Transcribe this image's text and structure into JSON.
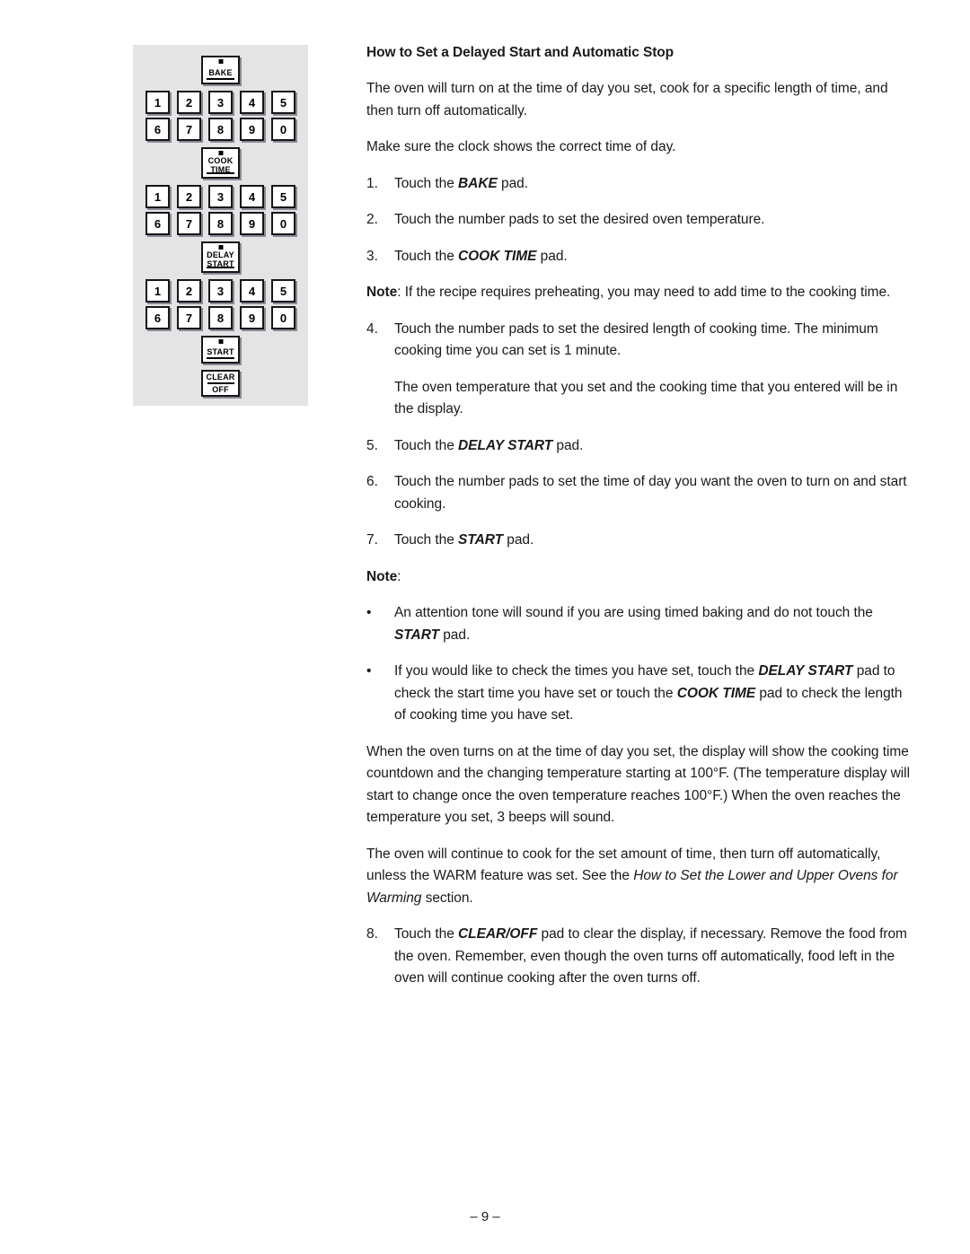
{
  "page": {
    "heading": "How to Set a Delayed Start and Automatic Stop",
    "footer": "– 9 –"
  },
  "keypad": {
    "background_color": "#e4e4e4",
    "key_border_color": "#161616",
    "key_shadow_color": "#8d8a96",
    "number_rows": [
      [
        "1",
        "2",
        "3",
        "4",
        "5"
      ],
      [
        "6",
        "7",
        "8",
        "9",
        "0"
      ]
    ],
    "function_keys": {
      "bake": "Bake",
      "cook_time_line1": "Cook",
      "cook_time_line2": "Time",
      "delay_start_line1": "Delay",
      "delay_start_line2": "Start",
      "start": "Start",
      "clear_off_line1": "Clear",
      "clear_off_line2": "Off"
    }
  },
  "body": {
    "intro_para_1": "The oven will turn on at the time of day you set, cook for a specific length of time, and then turn off automatically.",
    "intro_para_2": "Make sure the clock shows the correct time of day.",
    "steps": [
      {
        "marker": "1.",
        "pre": "Touch the ",
        "pad": "BAKE",
        "post": " pad."
      },
      {
        "marker": "2.",
        "pre": "Touch the number pads to set the desired oven temperature.",
        "pad": "",
        "post": ""
      },
      {
        "marker": "3.",
        "pre": "Touch the ",
        "pad": "COOK TIME",
        "post": " pad."
      }
    ],
    "note_preheat_label": "Note",
    "note_preheat_text": ": If the recipe requires preheating, you may need to add time to the cooking time.",
    "step4_marker": "4.",
    "step4_text": "Touch the number pads to set the desired length of cooking time. The minimum cooking time you can set is 1 minute.",
    "step4_sub": "The oven temperature that you set and the cooking time that you entered will be in the display.",
    "step5_marker": "5.",
    "step5_pre": "Touch the ",
    "step5_pad": "DELAY START",
    "step5_post": " pad.",
    "step6_marker": "6.",
    "step6_text": "Touch the number pads to set the time of day you want the oven to turn on and start cooking.",
    "step7_marker": "7.",
    "step7_pre": "Touch the ",
    "step7_pad": "START",
    "step7_post": " pad.",
    "note_label": "Note",
    "note_colon": ":",
    "bullet_marker": "•",
    "bullet1_pre": "An attention tone will sound if you are using timed baking and do not touch the ",
    "bullet1_pad": "START",
    "bullet1_post": " pad.",
    "bullet2_part1": "If you would like to check the times you have set, touch the ",
    "bullet2_pad1": "DELAY START",
    "bullet2_part2": " pad to check the start time you have set or touch the ",
    "bullet2_pad2": "COOK TIME",
    "bullet2_part3": " pad to check the length of cooking time you have set.",
    "para_when_oven": "When the oven turns on at the time of day you set, the display will show the cooking time countdown and the changing temperature starting at 100°F. (The temperature display will start to change once the oven temperature reaches 100°F.) When the oven reaches the temperature you set, 3 beeps will sound.",
    "para_continue_pre": "The oven will continue to cook for the set amount of time, then turn off automatically, unless the WARM feature was set. See the ",
    "para_continue_italic": "How to Set the Lower and Upper Ovens for Warming",
    "para_continue_post": " section.",
    "step8_marker": "8.",
    "step8_pre": "Touch the ",
    "step8_pad": "CLEAR/OFF",
    "step8_post": " pad to clear the display, if necessary. Remove the food from the oven. Remember, even though the oven turns off automatically, food left in the oven will continue cooking after the oven turns off."
  }
}
